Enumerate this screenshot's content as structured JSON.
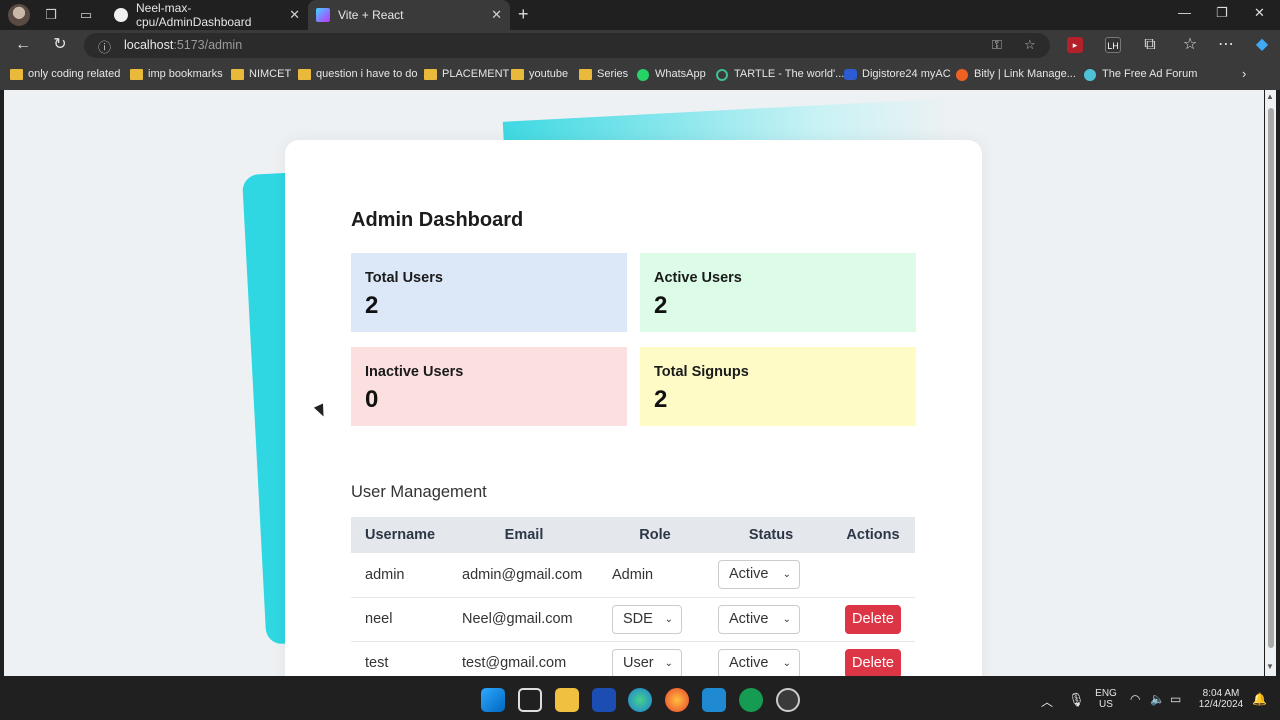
{
  "browser": {
    "tabs": [
      {
        "title": "Neel-max-cpu/AdminDashboard",
        "favicon": "github-icon"
      },
      {
        "title": "Vite + React",
        "favicon": "vite-icon"
      }
    ],
    "url_host": "localhost",
    "url_rest": ":5173/admin",
    "bookmarks": [
      "only coding  related",
      "imp bookmarks",
      "NIMCET",
      "question i have to do",
      "PLACEMENT",
      "youtube",
      "Series",
      "WhatsApp",
      "TARTLE - The world'...",
      "Digistore24 myAC",
      "Bitly | Link Manage...",
      "The Free Ad Forum"
    ]
  },
  "dashboard": {
    "title": "Admin Dashboard",
    "stats": [
      {
        "label": "Total Users",
        "value": "2",
        "color": "#dce8f8"
      },
      {
        "label": "Active Users",
        "value": "2",
        "color": "#dcfce7"
      },
      {
        "label": "Inactive Users",
        "value": "0",
        "color": "#fce0e0"
      },
      {
        "label": "Total Signups",
        "value": "2",
        "color": "#fefbc7"
      }
    ],
    "user_management_title": "User Management",
    "columns": [
      "Username",
      "Email",
      "Role",
      "Status",
      "Actions"
    ],
    "users": [
      {
        "username": "admin",
        "email": "admin@gmail.com",
        "role": "Admin",
        "status": "Active",
        "action": ""
      },
      {
        "username": "neel",
        "email": "Neel@gmail.com",
        "role": "SDE",
        "status": "Active",
        "action": "Delete"
      },
      {
        "username": "test",
        "email": "test@gmail.com",
        "role": "User",
        "status": "Active",
        "action": "Delete"
      }
    ]
  },
  "taskbar": {
    "lang_top": "ENG",
    "lang_bottom": "US",
    "time": "8:04 AM",
    "date": "12/4/2024"
  }
}
